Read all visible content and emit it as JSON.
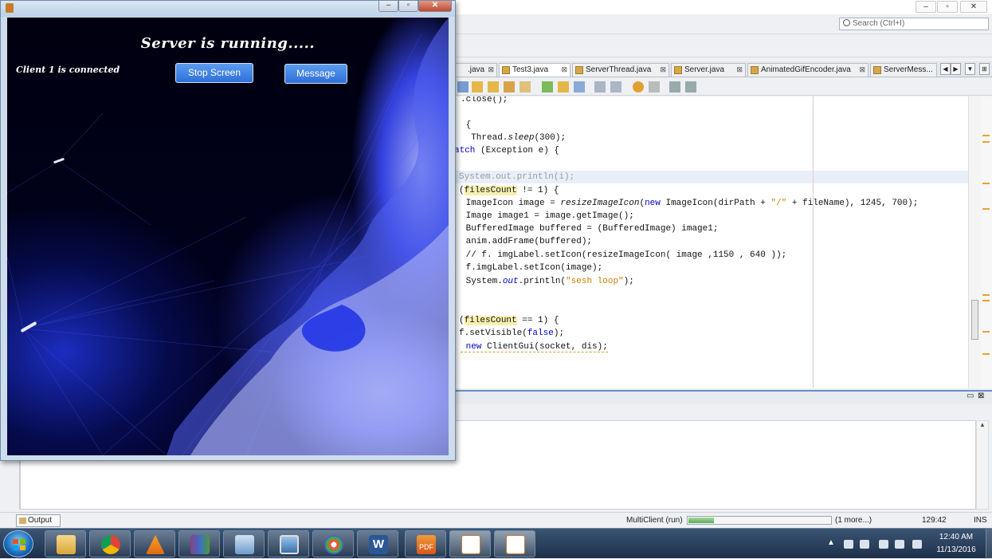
{
  "ide": {
    "search_placeholder": "Search (Ctrl+I)",
    "tabs": [
      {
        "label": ".java"
      },
      {
        "label": "Test3.java",
        "active": true
      },
      {
        "label": "ServerThread.java"
      },
      {
        "label": "Server.java"
      },
      {
        "label": "AnimatedGifEncoder.java"
      },
      {
        "label": "ServerMess..."
      }
    ],
    "code": [
      ".close();",
      "",
      " {",
      "  Thread.sleep(300);",
      "atch (Exception e) {",
      "",
      "System.out.println(i);",
      "(filesCount != 1) {",
      " ImageIcon image = resizeImageIcon(new ImageIcon(dirPath + \"/\" + fileName), 1245, 700);",
      " Image image1 = image.getImage();",
      " BufferedImage buffered = (BufferedImage) image1;",
      " anim.addFrame(buffered);",
      " // f. imgLabel.setIcon(resizeImageIcon( image ,1150 , 640 ));",
      " f.imgLabel.setIcon(image);",
      " System.out.println(\"sesh loop\");",
      "",
      "",
      "(filesCount == 1) {",
      "f.setVisible(false);",
      " new ClientGui(socket, dis);"
    ],
    "status": {
      "output_tab": "Output",
      "run_label": "MultiClient (run)",
      "progress": 0.18,
      "more": "(1 more...)",
      "position": "129:42",
      "mode": "INS"
    }
  },
  "server_window": {
    "title": "Server is running.....",
    "client_status": "Client 1 is connected",
    "stop_label": "Stop Screen",
    "message_label": "Message",
    "title_controls": [
      "–",
      "▫",
      "✕"
    ]
  },
  "taskbar": {
    "apps": [
      "file-explorer-icon",
      "chrome-icon",
      "vlc-icon",
      "winrar-icon",
      "virtualbox-icon",
      "photo-viewer-icon",
      "paint-icon",
      "word-icon",
      "pdf-icon",
      "java-icon",
      "java-icon"
    ],
    "time": "12:40 AM",
    "date": "11/13/2016"
  },
  "colors": {
    "button_blue": "#2e6fd8",
    "taskbar": "#1d3049",
    "keyword": "#0000cc",
    "string": "#ce7b00"
  }
}
